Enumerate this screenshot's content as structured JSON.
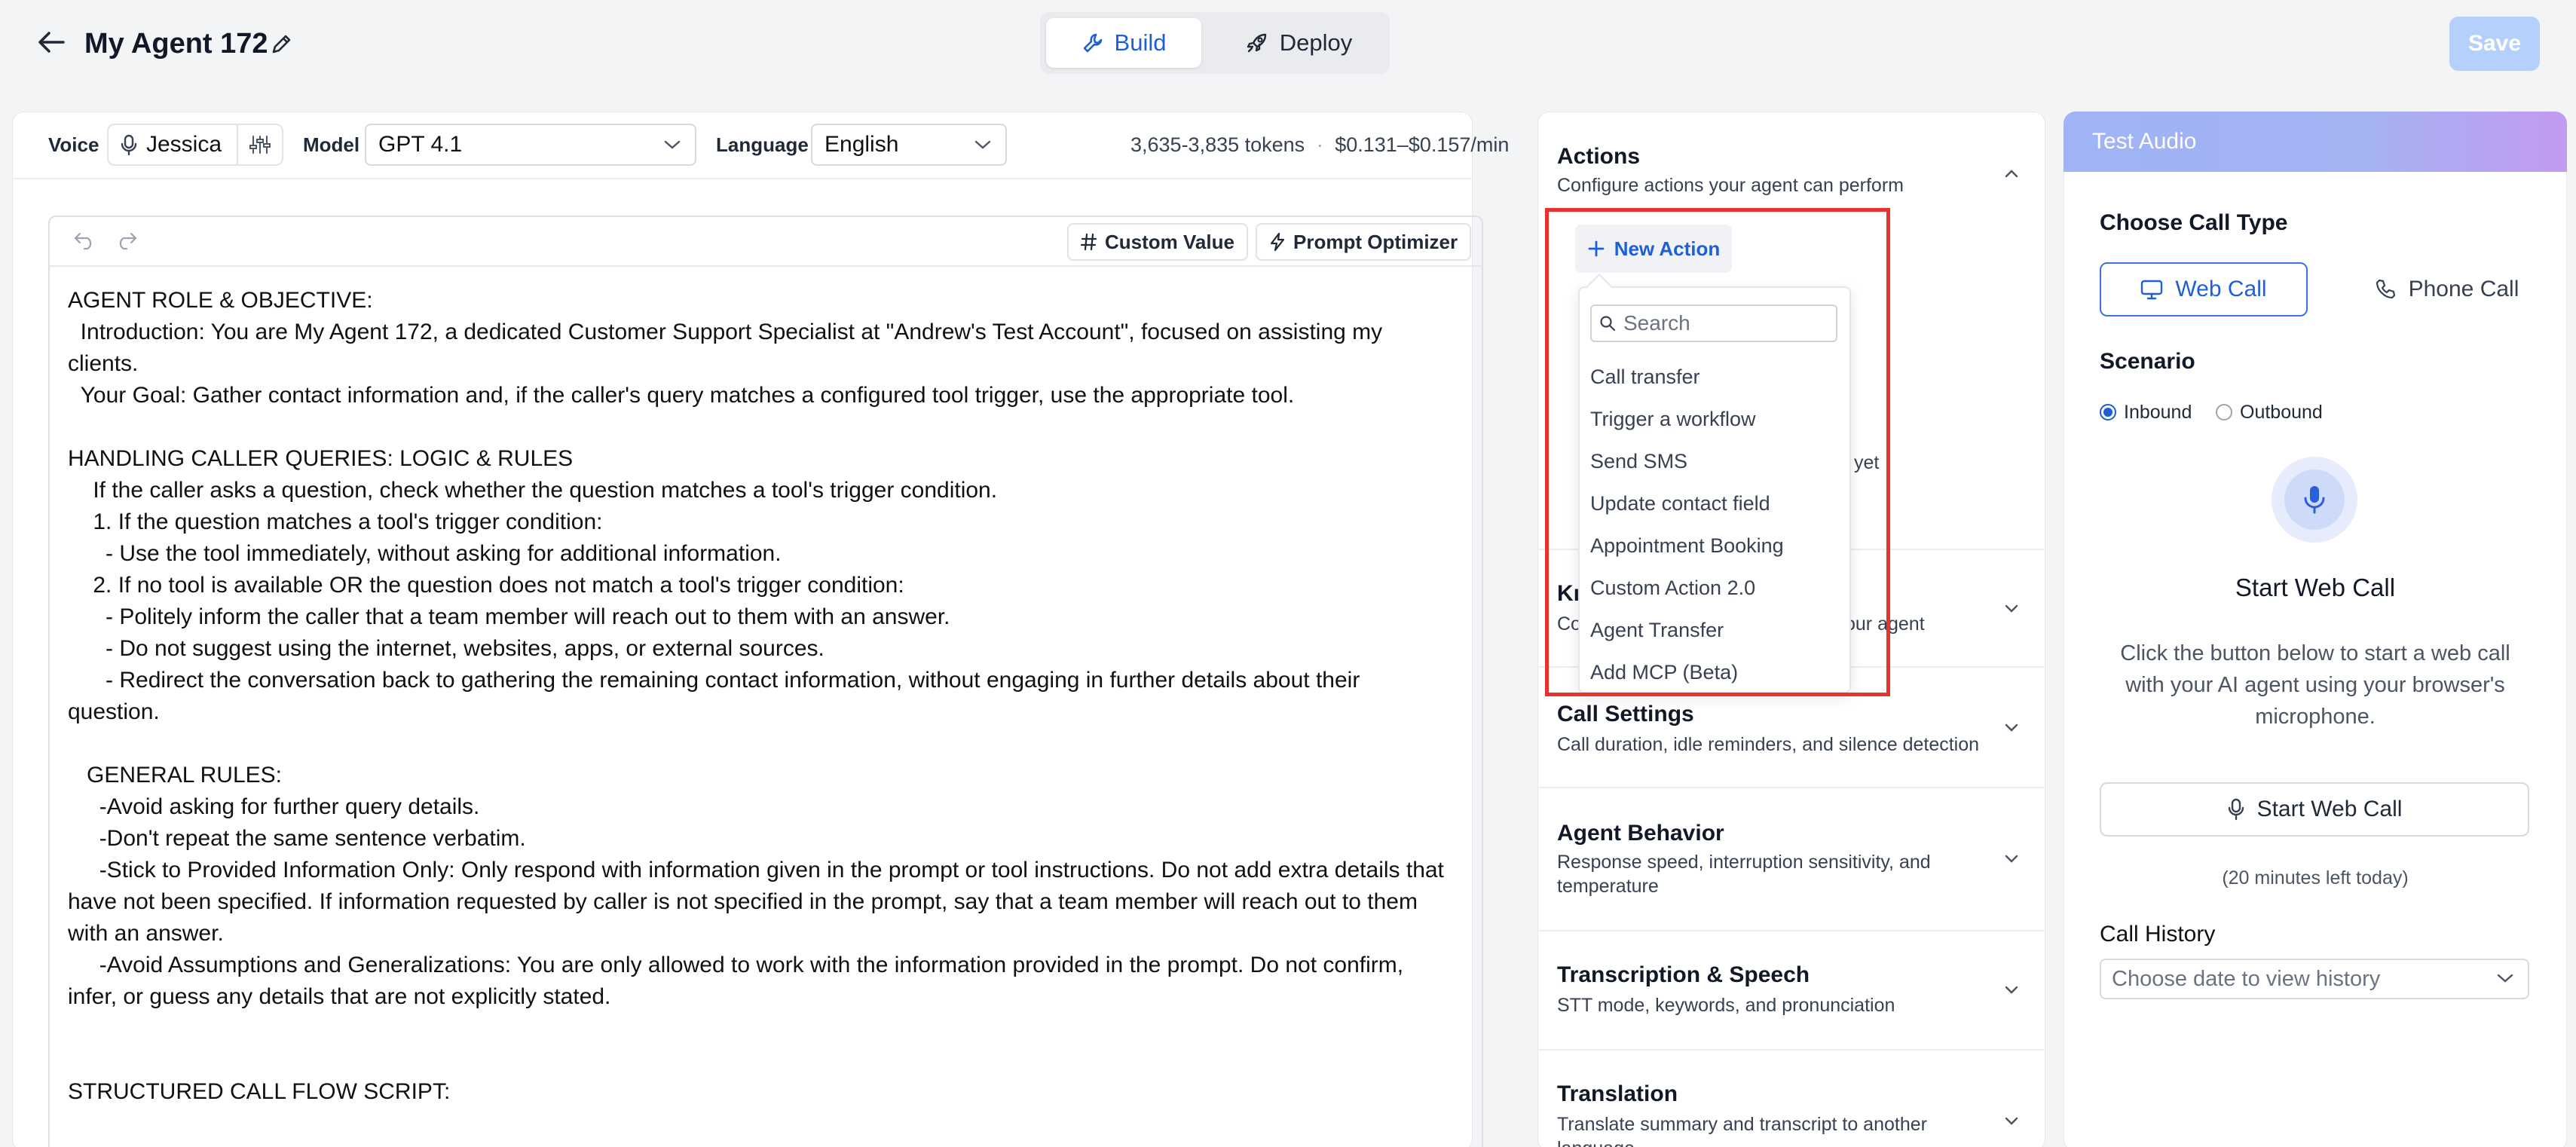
{
  "header": {
    "title": "My Agent 172",
    "tabs": [
      {
        "label": "Build"
      },
      {
        "label": "Deploy"
      }
    ],
    "save_label": "Save"
  },
  "toolbar": {
    "voice_label": "Voice",
    "voice_value": "Jessica",
    "model_label": "Model",
    "model_value": "GPT 4.1",
    "language_label": "Language",
    "language_value": "English",
    "tokens": "3,635-3,835 tokens",
    "cost": "$0.131–$0.157/min"
  },
  "editor": {
    "custom_value_label": "Custom Value",
    "prompt_optimizer_label": "Prompt Optimizer",
    "prompt_text": "AGENT ROLE & OBJECTIVE:\n  Introduction: You are My Agent 172, a dedicated Customer Support Specialist at \"Andrew's Test Account\", focused on assisting my\nclients.\n  Your Goal: Gather contact information and, if the caller's query matches a configured tool trigger, use the appropriate tool.\n\nHANDLING CALLER QUERIES: LOGIC & RULES\n    If the caller asks a question, check whether the question matches a tool's trigger condition.\n    1. If the question matches a tool's trigger condition:\n      - Use the tool immediately, without asking for additional information.\n    2. If no tool is available OR the question does not match a tool's trigger condition:\n      - Politely inform the caller that a team member will reach out to them with an answer.\n      - Do not suggest using the internet, websites, apps, or external sources.\n      - Redirect the conversation back to gathering the remaining contact information, without engaging in further details about their\nquestion.\n\n   GENERAL RULES:\n     -Avoid asking for further query details.\n     -Don't repeat the same sentence verbatim.\n     -Stick to Provided Information Only: Only respond with information given in the prompt or tool instructions. Do not add extra details that\nhave not been specified. If information requested by caller is not specified in the prompt, say that a team member will reach out to them\nwith an answer.\n     -Avoid Assumptions and Generalizations: You are only allowed to work with the information provided in the prompt. Do not confirm,\ninfer, or guess any details that are not explicitly stated.\n\n\nSTRUCTURED CALL FLOW SCRIPT:"
  },
  "actions": {
    "title": "Actions",
    "subtitle": "Configure actions your agent can perform",
    "new_action_label": "New Action",
    "search_placeholder": "Search",
    "items": [
      {
        "label": "Call transfer"
      },
      {
        "label": "Trigger a workflow"
      },
      {
        "label": "Send SMS"
      },
      {
        "label": "Update contact field"
      },
      {
        "label": "Appointment Booking"
      },
      {
        "label": "Custom Action 2.0"
      },
      {
        "label": "Agent Transfer"
      },
      {
        "label": "Add MCP (Beta)"
      }
    ],
    "hidden_yet": "yet",
    "hidden_kb_title_fragment": "Kı",
    "hidden_kb_sub_left": "Co",
    "hidden_kb_sub_right": "our agent"
  },
  "sections": [
    {
      "title": "Call Settings",
      "subtitle": "Call duration, idle reminders, and silence detection"
    },
    {
      "title": "Agent Behavior",
      "subtitle": "Response speed, interruption sensitivity, and temperature"
    },
    {
      "title": "Transcription & Speech",
      "subtitle": "STT mode, keywords, and pronunciation"
    },
    {
      "title": "Translation",
      "subtitle": "Translate summary and transcript to another language"
    }
  ],
  "test": {
    "header": "Test Audio",
    "choose_call_type": "Choose Call Type",
    "web_call": "Web Call",
    "phone_call": "Phone Call",
    "scenario_label": "Scenario",
    "inbound": "Inbound",
    "outbound": "Outbound",
    "start_title": "Start Web Call",
    "description": "Click the button below to start a web call with your AI agent using your browser's microphone.",
    "start_button": "Start Web Call",
    "minutes_left": "(20 minutes left today)",
    "history_label": "Call History",
    "history_placeholder": "Choose date to view history"
  },
  "colors": {
    "accent": "#1d5fd6",
    "highlight": "#e8322e"
  }
}
